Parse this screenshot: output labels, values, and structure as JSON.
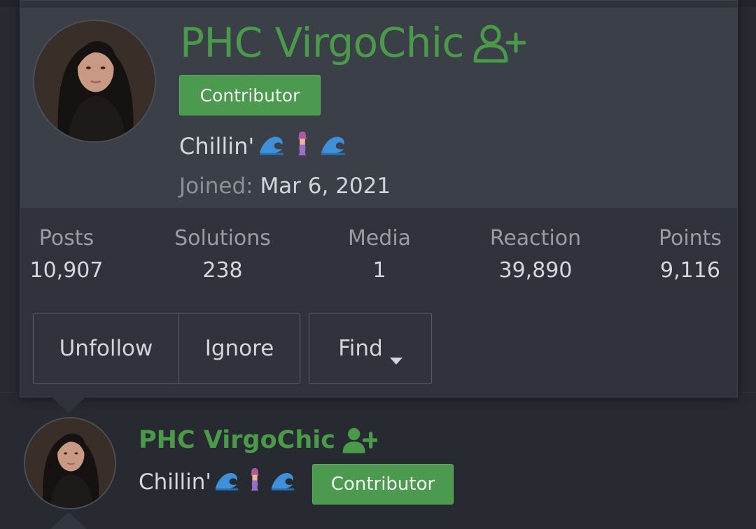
{
  "profile_card": {
    "username": "PHC VirgoChic",
    "badge": "Contributor",
    "status_text": "Chillin'",
    "joined_label": "Joined:",
    "joined_value": "Mar 6, 2021",
    "follow_icon": "user-plus-icon",
    "status_emoji": [
      "wave-emoji",
      "mermaid-emoji",
      "wave-emoji"
    ]
  },
  "stats": [
    {
      "label": "Posts",
      "value": "10,907"
    },
    {
      "label": "Solutions",
      "value": "238"
    },
    {
      "label": "Media",
      "value": "1"
    },
    {
      "label": "Reaction",
      "value": "39,890"
    },
    {
      "label": "Points",
      "value": "9,116"
    }
  ],
  "actions": {
    "unfollow": "Unfollow",
    "ignore": "Ignore",
    "find": "Find"
  },
  "post_author": {
    "username": "PHC VirgoChic",
    "status_text": "Chillin'",
    "badge": "Contributor"
  },
  "colors": {
    "username_green": "#4a9a4a",
    "badge_green": "#4c9a4f",
    "card_bg": "#30333b",
    "card_head_bg": "#3a3f48",
    "page_bg": "#272a31"
  }
}
